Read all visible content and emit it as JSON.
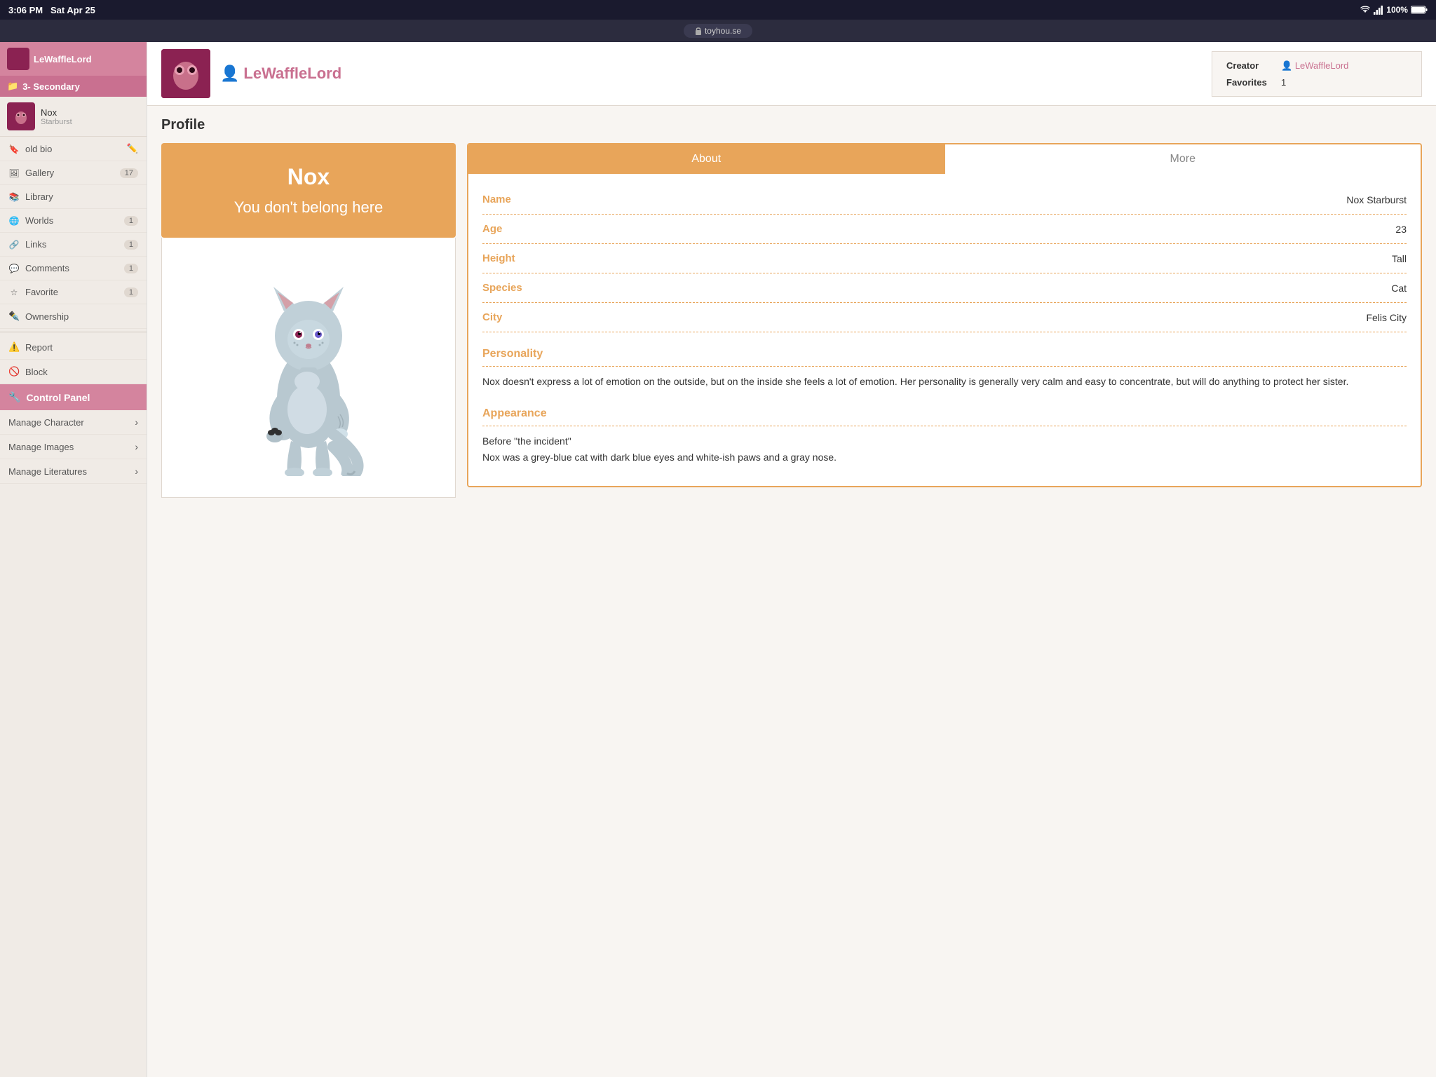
{
  "statusBar": {
    "time": "3:06 PM",
    "date": "Sat Apr 25",
    "url": "toyhou.se",
    "battery": "100%"
  },
  "sidebar": {
    "username": "LeWaffleLord",
    "folder": "3- Secondary",
    "character": {
      "name": "Nox",
      "subtitle": "Starburst"
    },
    "navItems": [
      {
        "icon": "bookmark",
        "label": "old bio",
        "badge": null,
        "hasEdit": true
      },
      {
        "icon": "photo",
        "label": "Gallery",
        "badge": "17"
      },
      {
        "icon": "book",
        "label": "Library",
        "badge": null
      },
      {
        "icon": "globe",
        "label": "Worlds",
        "badge": "1"
      },
      {
        "icon": "link",
        "label": "Links",
        "badge": "1"
      },
      {
        "icon": "comment",
        "label": "Comments",
        "badge": "1"
      },
      {
        "icon": "star",
        "label": "Favorite",
        "badge": "1"
      },
      {
        "icon": "ownership",
        "label": "Ownership",
        "badge": null
      },
      {
        "icon": "report",
        "label": "Report",
        "badge": null
      },
      {
        "icon": "block",
        "label": "Block",
        "badge": null
      }
    ],
    "controlPanel": "Control Panel",
    "manageItems": [
      {
        "label": "Manage Character",
        "hasArrow": true
      },
      {
        "label": "Manage Images",
        "hasArrow": true
      },
      {
        "label": "Manage Literatures",
        "hasArrow": true
      }
    ]
  },
  "charHeader": {
    "creatorLabel": "Creator",
    "creatorName": "LeWaffleLord",
    "favoritesLabel": "Favorites",
    "favoritesCount": "1"
  },
  "charNameHeader": "LeWaffleLord",
  "profile": {
    "sectionTitle": "Profile",
    "banner": {
      "name": "Nox",
      "tagline": "You don't belong here"
    },
    "tabs": {
      "about": "About",
      "more": "More"
    },
    "fields": [
      {
        "key": "Name",
        "value": "Nox Starburst"
      },
      {
        "key": "Age",
        "value": "23"
      },
      {
        "key": "Height",
        "value": "Tall"
      },
      {
        "key": "Species",
        "value": "Cat"
      },
      {
        "key": "City",
        "value": "Felis City"
      }
    ],
    "personality": {
      "header": "Personality",
      "text": "Nox doesn't express a lot of emotion on the outside, but on the inside she feels a lot of emotion. Her personality is generally very calm and easy to concentrate, but will do anything to protect her sister."
    },
    "appearance": {
      "header": "Appearance",
      "text": "Before \"the incident\"\nNox was a grey-blue cat with dark blue eyes and white-ish paws and a gray nose."
    }
  }
}
